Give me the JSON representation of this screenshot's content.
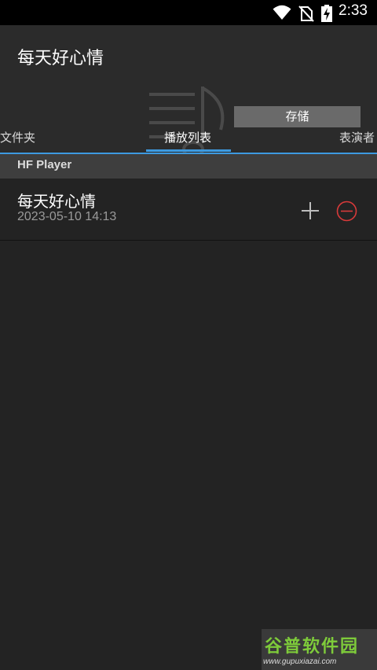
{
  "status_bar": {
    "time": "2:33"
  },
  "header": {
    "title": "每天好心情",
    "save_label": "存储",
    "tabs": [
      {
        "label": "文件夹",
        "active": false
      },
      {
        "label": "播放列表",
        "active": true
      },
      {
        "label": "表演者",
        "active": false
      }
    ]
  },
  "section": {
    "title": "HF Player"
  },
  "playlist": [
    {
      "title": "每天好心情",
      "date": "2023-05-10 14:13"
    }
  ],
  "watermark": {
    "title": "谷普软件园",
    "url": "www.gupuxiazai.com"
  },
  "colors": {
    "accent": "#3d9ae0",
    "remove": "#d83a3a",
    "background": "#232323",
    "header": "#2b2b2b"
  }
}
